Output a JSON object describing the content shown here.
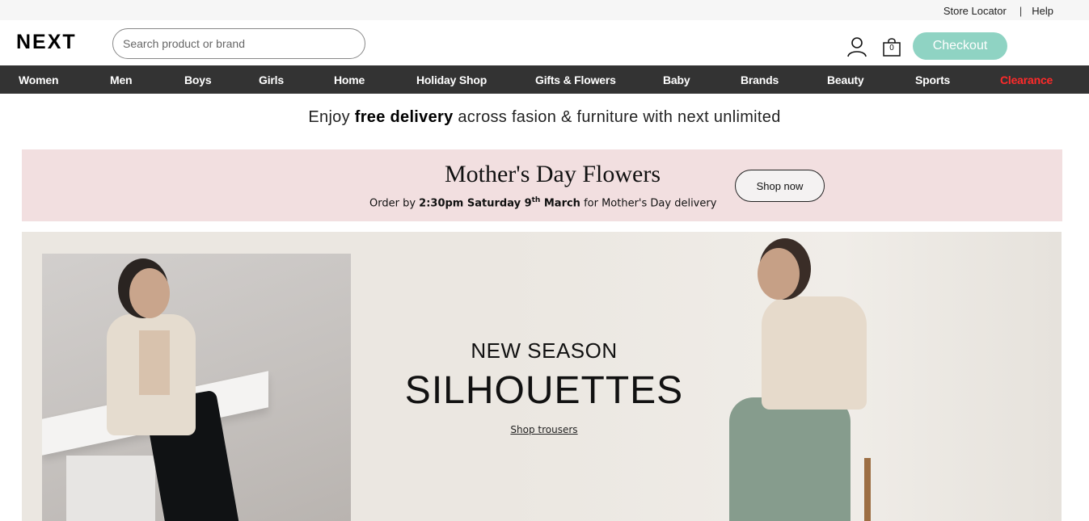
{
  "utility": {
    "store_locator": "Store Locator",
    "separator": "|",
    "help": "Help"
  },
  "header": {
    "logo": "NEXT",
    "search_placeholder": "Search product or brand",
    "bag_count": "0",
    "checkout_label": "Checkout",
    "checkout_color": "#8fd3c3"
  },
  "nav": {
    "items": [
      {
        "label": "Women"
      },
      {
        "label": "Men"
      },
      {
        "label": "Boys"
      },
      {
        "label": "Girls"
      },
      {
        "label": "Home"
      },
      {
        "label": "Holiday Shop"
      },
      {
        "label": "Gifts & Flowers"
      },
      {
        "label": "Baby"
      },
      {
        "label": "Brands"
      },
      {
        "label": "Beauty"
      },
      {
        "label": "Sports"
      },
      {
        "label": "Clearance"
      }
    ],
    "clearance_color": "#ff2a2a"
  },
  "promo": {
    "before": "Enjoy ",
    "bold": "free delivery",
    "after": " across fasion & furniture with next unlimited"
  },
  "mothers_day": {
    "title": "Mother's Day Flowers",
    "order_prefix": "Order by ",
    "order_bold_a": "2:30pm Saturday 9",
    "order_sup": "th",
    "order_bold_b": " March",
    "order_suffix": " for Mother's Day delivery",
    "button": "Shop now",
    "background": "#f2dfe0"
  },
  "hero": {
    "eyebrow": "NEW SEASON",
    "headline": "SILHOUETTES",
    "link": "Shop trousers"
  }
}
